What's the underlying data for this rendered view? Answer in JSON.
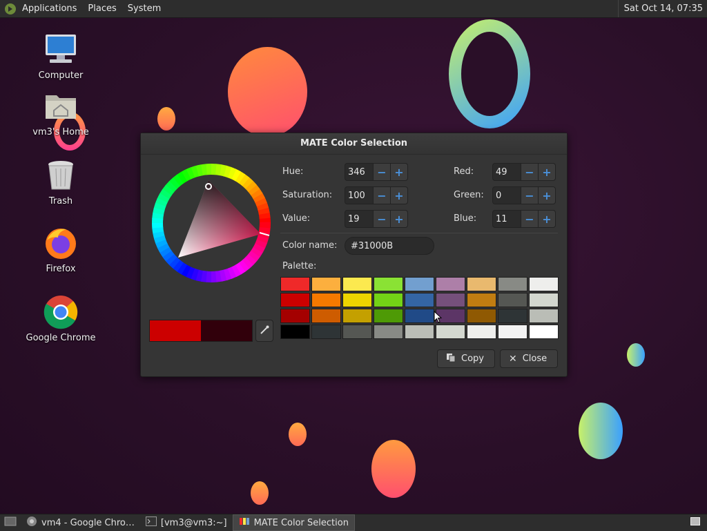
{
  "top_panel": {
    "menus": [
      "Applications",
      "Places",
      "System"
    ],
    "clock": "Sat Oct 14, 07:35"
  },
  "desktop_icons": [
    {
      "label": "Computer",
      "icon": "computer-icon"
    },
    {
      "label": "vm3's Home",
      "icon": "home-folder-icon"
    },
    {
      "label": "Trash",
      "icon": "trash-icon"
    },
    {
      "label": "Firefox",
      "icon": "firefox-icon"
    },
    {
      "label": "Google Chrome",
      "icon": "chrome-icon"
    }
  ],
  "dialog": {
    "title": "MATE Color Selection",
    "hue_label": "Hue:",
    "hue": "346",
    "saturation_label": "Saturation:",
    "saturation": "100",
    "value_label": "Value:",
    "value": "19",
    "red_label": "Red:",
    "red": "49",
    "green_label": "Green:",
    "green": "0",
    "blue_label": "Blue:",
    "blue": "11",
    "color_name_label": "Color name:",
    "color_name": "#31000B",
    "palette_label": "Palette:",
    "palette": [
      "#ef2929",
      "#fcaf3e",
      "#fce94f",
      "#8ae234",
      "#729fcf",
      "#ad7fa8",
      "#e9b96e",
      "#888a85",
      "#eeeeec",
      "#cc0000",
      "#f57900",
      "#edd400",
      "#73d216",
      "#3465a4",
      "#75507b",
      "#c17d11",
      "#555753",
      "#d3d7cf",
      "#a40000",
      "#ce5c00",
      "#c4a000",
      "#4e9a06",
      "#204a87",
      "#5c3566",
      "#8f5902",
      "#2e3436",
      "#babdb6",
      "#000000",
      "#2e3436",
      "#555753",
      "#888a85",
      "#babdb6",
      "#d3d7cf",
      "#eeeeec",
      "#f3f3f3",
      "#ffffff"
    ],
    "preview_previous": "#cc0000",
    "preview_current": "#31000b",
    "copy_label": "Copy",
    "close_label": "Close"
  },
  "taskbar": [
    {
      "label": "vm4 - Google Chro…",
      "icon": "chrome-icon",
      "active": false
    },
    {
      "label": "[vm3@vm3:~]",
      "icon": "terminal-icon",
      "active": false
    },
    {
      "label": "MATE Color Selection",
      "icon": "color-selector-icon",
      "active": true
    }
  ]
}
